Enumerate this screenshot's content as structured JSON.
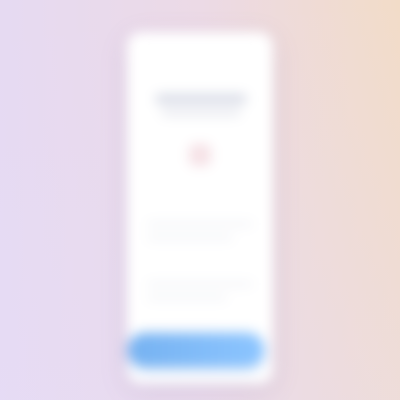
{
  "app": {
    "title": ""
  },
  "header": {
    "title": "",
    "subtitle": ""
  },
  "content": {
    "lines": [
      "",
      "",
      "",
      ""
    ]
  },
  "cta": {
    "label": ""
  },
  "icons": {
    "center_icon": "app-icon"
  },
  "colors": {
    "background_left": "#e6daf2",
    "background_right": "#f2dcc8",
    "card": "#ffffff",
    "button": "#76b2f1"
  }
}
